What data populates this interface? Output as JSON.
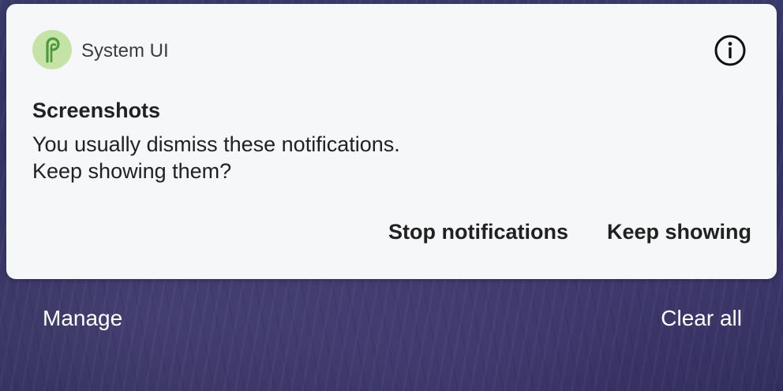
{
  "notification": {
    "app_name": "System UI",
    "app_icon": "android-p-icon",
    "info_icon": "info-icon",
    "title": "Screenshots",
    "message_line1": "You usually dismiss these notifications.",
    "message_line2": "Keep showing them?",
    "actions": {
      "stop": "Stop notifications",
      "keep": "Keep showing"
    }
  },
  "footer": {
    "manage": "Manage",
    "clear_all": "Clear all"
  },
  "colors": {
    "card_background": "#f6f7f9",
    "icon_background": "#c5e3a6",
    "icon_foreground": "#4a9a3c",
    "text_primary": "#212121",
    "footer_text": "#ffffff"
  }
}
